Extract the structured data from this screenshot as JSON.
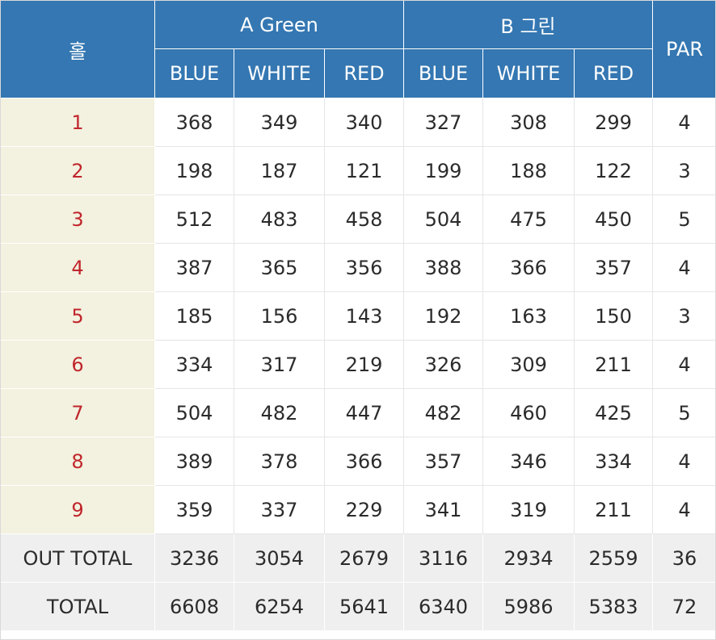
{
  "header": {
    "hole_label": "홀",
    "group_a": "A Green",
    "group_b": "B 그린",
    "par_label": "PAR",
    "tees": [
      "BLUE",
      "WHITE",
      "RED",
      "BLUE",
      "WHITE",
      "RED"
    ]
  },
  "rows": [
    {
      "hole": "1",
      "values": [
        "368",
        "349",
        "340",
        "327",
        "308",
        "299"
      ],
      "par": "4"
    },
    {
      "hole": "2",
      "values": [
        "198",
        "187",
        "121",
        "199",
        "188",
        "122"
      ],
      "par": "3"
    },
    {
      "hole": "3",
      "values": [
        "512",
        "483",
        "458",
        "504",
        "475",
        "450"
      ],
      "par": "5"
    },
    {
      "hole": "4",
      "values": [
        "387",
        "365",
        "356",
        "388",
        "366",
        "357"
      ],
      "par": "4"
    },
    {
      "hole": "5",
      "values": [
        "185",
        "156",
        "143",
        "192",
        "163",
        "150"
      ],
      "par": "3"
    },
    {
      "hole": "6",
      "values": [
        "334",
        "317",
        "219",
        "326",
        "309",
        "211"
      ],
      "par": "4"
    },
    {
      "hole": "7",
      "values": [
        "504",
        "482",
        "447",
        "482",
        "460",
        "425"
      ],
      "par": "5"
    },
    {
      "hole": "8",
      "values": [
        "389",
        "378",
        "366",
        "357",
        "346",
        "334"
      ],
      "par": "4"
    },
    {
      "hole": "9",
      "values": [
        "359",
        "337",
        "229",
        "341",
        "319",
        "211"
      ],
      "par": "4"
    }
  ],
  "totals": [
    {
      "label": "OUT TOTAL",
      "values": [
        "3236",
        "3054",
        "2679",
        "3116",
        "2934",
        "2559"
      ],
      "par": "36"
    },
    {
      "label": "TOTAL",
      "values": [
        "6608",
        "6254",
        "5641",
        "6340",
        "5986",
        "5383"
      ],
      "par": "72"
    }
  ],
  "colors": {
    "header_bg": "#3477b2",
    "hole_bg": "#f3f1df",
    "hole_text": "#c0262c",
    "total_bg": "#efefef"
  }
}
